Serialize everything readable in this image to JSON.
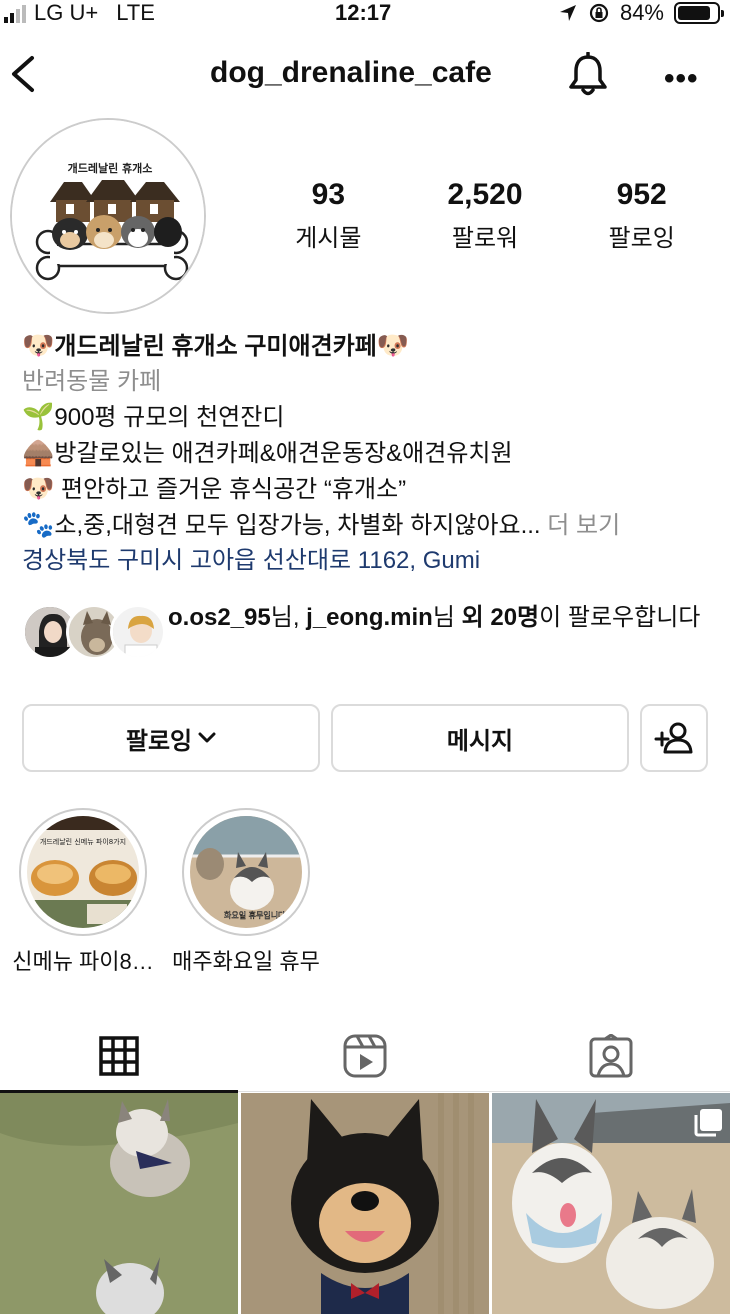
{
  "status_bar": {
    "carrier": "LG U+",
    "network": "LTE",
    "time": "12:17",
    "battery": "84%",
    "battery_level": 0.84
  },
  "header": {
    "username": "dog_drenaline_cafe"
  },
  "stats": [
    {
      "value": "93",
      "label": "게시물"
    },
    {
      "value": "2,520",
      "label": "팔로워"
    },
    {
      "value": "952",
      "label": "팔로잉"
    }
  ],
  "bio": {
    "name": "개드레날린 휴개소 구미애견카페",
    "category": "반려동물 카페",
    "line1": "900평 규모의 천연잔디",
    "line2": "방갈로있는 애견카페&애견운동장&애견유치원",
    "line3": " 편안하고 즐거운 휴식공간 “휴개소”",
    "line4": "소,중,대형견 모두 입장가능, 차별화 하지않아요...",
    "more": " 더 보기",
    "address": "경상북도 구미시 고아읍 선산대로 1162, Gumi"
  },
  "logo_text": "개드레날린 휴개소",
  "followed_by": {
    "user1": "o.os2_95",
    "sep1": "님, ",
    "user2": "j_eong.min",
    "sep2": "님 ",
    "others": "외 20명",
    "suffix": "이 팔로우합니다"
  },
  "buttons": {
    "following": "팔로잉",
    "message": "메시지"
  },
  "highlights": [
    {
      "label": "신메뉴 파이8…",
      "thumb_text": "개드레날린 신메뉴 파이8가지"
    },
    {
      "label": "매주화요일 휴무",
      "thumb_text": "화요일 휴무입니다"
    }
  ],
  "colors": {
    "accent_link": "#1e3a6e",
    "secondary_text": "#8e8e8e",
    "border": "#dbdbdb"
  }
}
